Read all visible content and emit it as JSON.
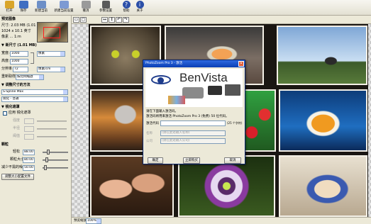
{
  "toolbar": {
    "buttons": [
      {
        "label": "打开",
        "icon": "folder-open-icon",
        "color": "#d9a52a"
      },
      {
        "label": "保存",
        "icon": "save-icon",
        "color": "#3f6ec2"
      },
      {
        "label": "新建当前",
        "icon": "new-document-icon",
        "color": "#6d8fc7"
      },
      {
        "label": "新建当前设置",
        "icon": "layout-icon",
        "color": "#7d9ad3"
      },
      {
        "label": "撤消",
        "icon": "undo-icon",
        "color": "#9a9a9a"
      },
      {
        "label": "参数设置",
        "icon": "tools-icon",
        "color": "#5a5a5a"
      },
      {
        "label": "帮助",
        "icon": "help-icon",
        "color": "#2b4fa8"
      },
      {
        "label": "关于",
        "icon": "about-icon",
        "color": "#2b4fa8"
      }
    ]
  },
  "left_panel": {
    "section_preview": "预览图像",
    "size_info_line1": "尺寸: 2.03 MB (1.01 MB)",
    "size_info_line2": "1024 x 10.1 英寸",
    "size_info_line3": "像素 ... 1:m",
    "section_size": "▼ 新尺寸 (1.01 MB)",
    "width_label": "宽度:",
    "width_value": "1000",
    "width_unit": "像素",
    "height_label": "高度:",
    "height_value": "1000",
    "resolution_label": "分辨率",
    "resolution_value": "72",
    "resolution_unit": "像素/cm",
    "resample_label": "重新取样",
    "resample_value": "按比例缩放",
    "section_method": "▼ 调整尺寸的方法",
    "method_value": "S-Spline Max",
    "sharpen_label": "锐化 - 普通",
    "section_sharpen": "▼ 锐化遮罩",
    "unsharp_check_label": "应用 锐化遮罩",
    "amount_label": "强度",
    "radius_label": "半径",
    "threshold_label": "阈值",
    "section_film": "颗粒",
    "grain_amount_label": "轻松",
    "grain_amount_value": "88.00",
    "grain_size_label": "颗粒大小",
    "grain_size_value": "80.00",
    "grain_reduce_label": "减少不需的噪",
    "grain_reduce_value": "50.00",
    "apply_button": "调整大小配置文件"
  },
  "statusbar": {
    "label": "预览缩放",
    "zoom": "100%"
  },
  "dialog": {
    "title": "PhotoZoom Pro 3 - 激活",
    "close_glyph": "×",
    "brand": "BenVista",
    "info_line1": "请在下面输入激活码。",
    "info_line2": "激活码将用来激活 PhotoZoom Pro 3 (免费) 50 位代码。",
    "code_label": "激活代码",
    "code_note": "(25 个字符)",
    "field1_label": "名称",
    "field1_placeholder": "(请在此处输入名称)",
    "field2_label": "公司",
    "field2_placeholder": "(请在此处输入公司)",
    "button_ok": "确定",
    "button_buy": "立即购买",
    "button_cancel": "取消"
  }
}
